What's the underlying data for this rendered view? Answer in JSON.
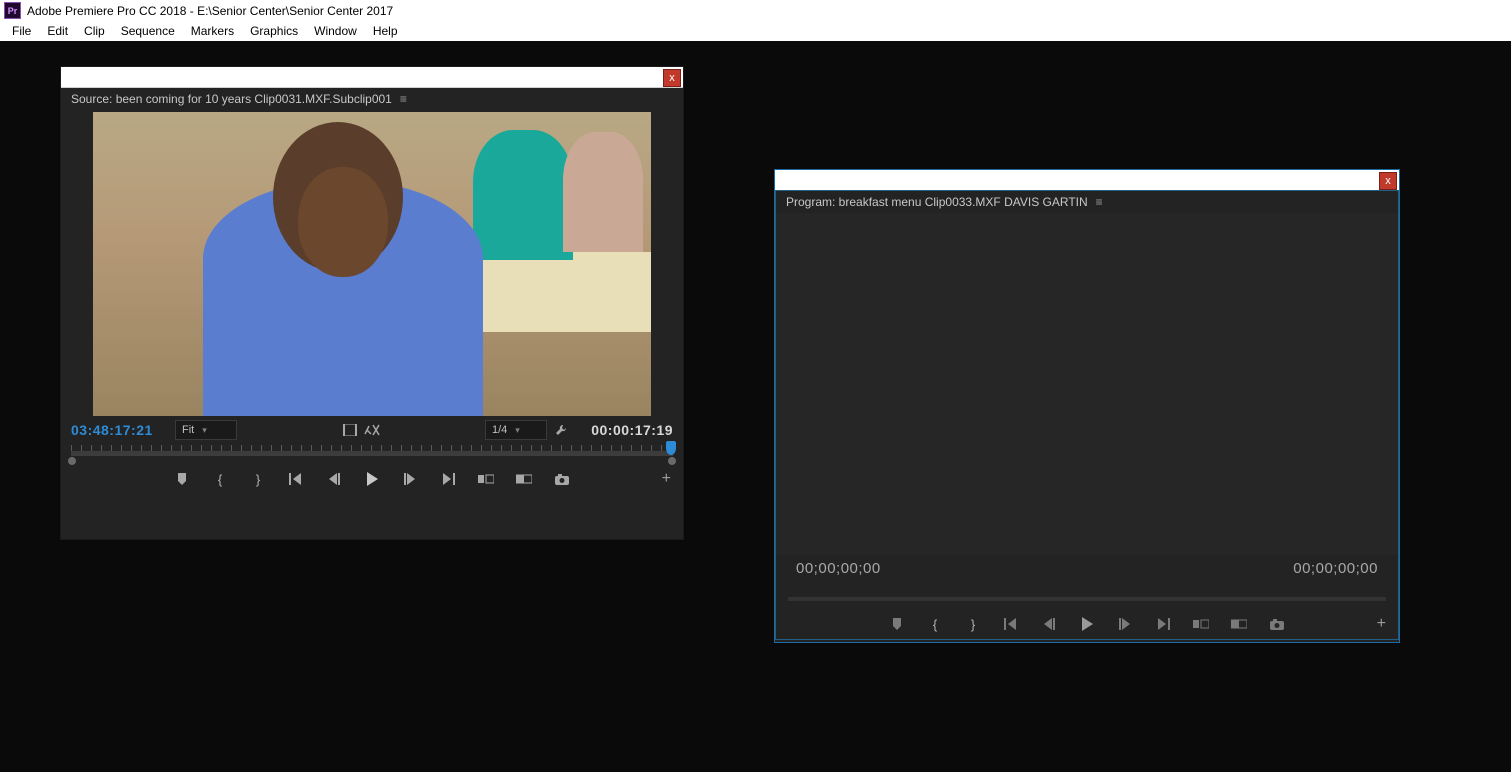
{
  "app": {
    "icon_label": "Pr",
    "title": "Adobe Premiere Pro CC 2018 - E:\\Senior Center\\Senior Center 2017"
  },
  "menu": {
    "items": [
      "File",
      "Edit",
      "Clip",
      "Sequence",
      "Markers",
      "Graphics",
      "Window",
      "Help"
    ]
  },
  "source_panel": {
    "header": "Source: been coming for 10 years Clip0031.MXF.Subclip001",
    "tc_in": "03:48:17:21",
    "tc_out": "00:00:17:19",
    "fit_label": "Fit",
    "res_label": "1/4",
    "close_glyph": "x",
    "transport": {
      "add_marker": "▼",
      "in_point": "{",
      "out_point": "}",
      "goto_in": "|←",
      "step_back": "◀|",
      "play": "▶",
      "step_fwd": "|▶",
      "goto_out": "→|",
      "insert": "⊞",
      "overwrite": "⊟",
      "export_frame": "◙",
      "plus": "+"
    }
  },
  "program_panel": {
    "header": "Program: breakfast menu Clip0033.MXF DAVIS GARTIN",
    "tc_left": "00;00;00;00",
    "tc_right": "00;00;00;00",
    "close_glyph": "x",
    "transport": {
      "add_marker": "▼",
      "in_point": "{",
      "out_point": "}",
      "goto_in": "|←",
      "step_back": "◀|",
      "play": "▶",
      "step_fwd": "|▶",
      "goto_out": "→|",
      "lift": "⊞",
      "extract": "⊟",
      "export_frame": "◙",
      "plus": "+"
    }
  }
}
